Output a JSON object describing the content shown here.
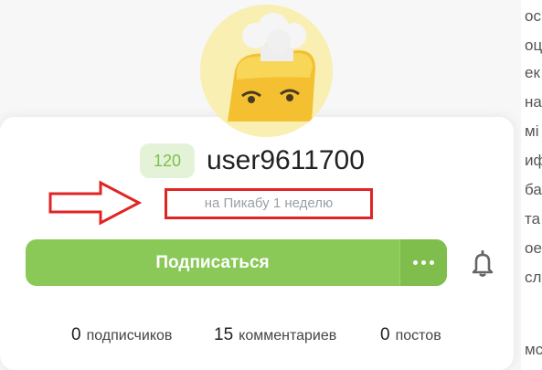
{
  "profile": {
    "rating": "120",
    "username": "user9611700",
    "member_since": "на Пикабу 1 неделю"
  },
  "actions": {
    "subscribe_label": "Подписаться",
    "more_icon": "more-dots-icon",
    "bell_icon": "bell-icon"
  },
  "stats": [
    {
      "count": "0",
      "label": "подписчиков"
    },
    {
      "count": "15",
      "label": "комментариев"
    },
    {
      "count": "0",
      "label": "постов"
    }
  ],
  "sidebar_fragments": [
    "ос",
    "оц",
    "ек",
    "на",
    "мі",
    "иф",
    "ба",
    "та",
    "ое",
    "сл",
    "мс"
  ],
  "colors": {
    "accent_green": "#8ac858",
    "badge_bg": "#e4f3d8",
    "badge_text": "#7cbf4a",
    "highlight_red": "#e12424",
    "avatar_bg": "#f9efb3"
  }
}
